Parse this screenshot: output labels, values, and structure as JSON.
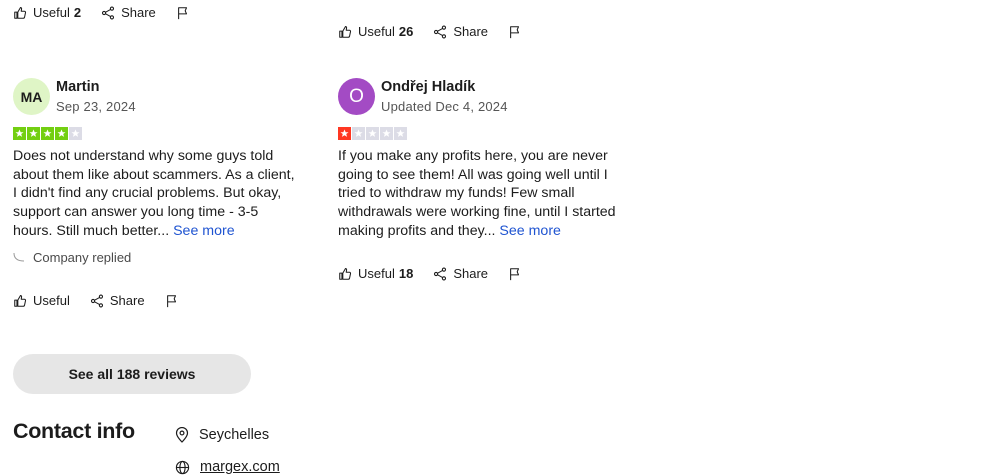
{
  "top_actions": [
    {
      "useful_label": "Useful",
      "useful_count": "2",
      "share_label": "Share"
    },
    {
      "useful_label": "Useful",
      "useful_count": "26",
      "share_label": "Share"
    }
  ],
  "reviews": [
    {
      "avatar_initials": "MA",
      "name": "Martin",
      "date": "Sep 23, 2024",
      "rating": 4,
      "rating_color": "#73cf11",
      "text": "Does not understand why some guys told about them like about scammers. As a client, I didn't find any crucial problems. But okay, support can answer you long time - 3-5 hours. Still much better...",
      "see_more": "See more",
      "company_replied": "Company replied",
      "useful_label": "Useful",
      "share_label": "Share"
    },
    {
      "avatar_initials": "O",
      "name": "Ondřej Hladík",
      "date": "Updated Dec 4, 2024",
      "rating": 1,
      "rating_color": "#ff3722",
      "text": "If you make any profits here, you are never going to see them! All was going well until I tried to withdraw my funds! Few small withdrawals were working fine, until I started making profits and they...",
      "see_more": "See more",
      "useful_label": "Useful",
      "useful_count": "18",
      "share_label": "Share"
    }
  ],
  "see_all_label": "See all 188 reviews",
  "contact": {
    "title": "Contact info",
    "location": "Seychelles",
    "website": "margex.com"
  },
  "colors": {
    "link": "#1f54d1",
    "empty_star": "#dcdce6"
  }
}
